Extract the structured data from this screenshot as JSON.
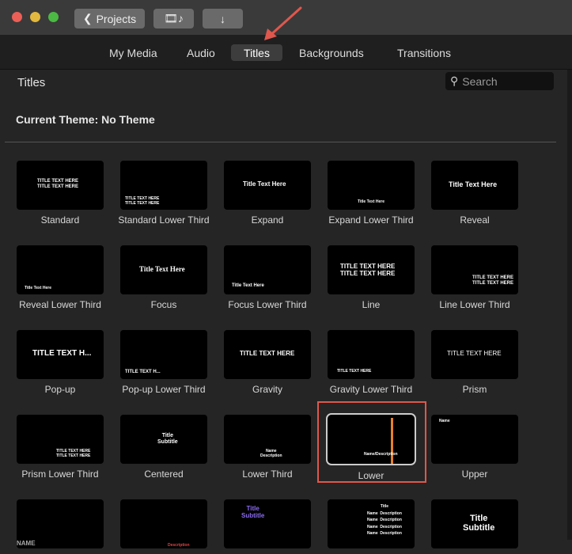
{
  "toolbar": {
    "projects_label": "Projects",
    "media_icon": "film-music-icon",
    "import_icon": "down-arrow-icon"
  },
  "tabs": [
    {
      "label": "My Media"
    },
    {
      "label": "Audio"
    },
    {
      "label": "Titles",
      "active": true
    },
    {
      "label": "Backgrounds"
    },
    {
      "label": "Transitions"
    }
  ],
  "header": {
    "title": "Titles",
    "search_placeholder": "Search"
  },
  "theme": "Current Theme: No Theme",
  "colors": {
    "accent_arrow": "#e0574d",
    "selection": "#e0574d"
  },
  "items": [
    {
      "label": "Standard",
      "preview": "TITLE TEXT HERE\nTITLE TEXT HERE"
    },
    {
      "label": "Standard Lower Third",
      "preview": "TITLE TEXT HERE\nTITLE TEXT HERE"
    },
    {
      "label": "Expand",
      "preview": "Title Text Here"
    },
    {
      "label": "Expand Lower Third",
      "preview": "Title Text Here"
    },
    {
      "label": "Reveal",
      "preview": "Title Text Here"
    },
    {
      "label": "Reveal Lower Third",
      "preview": "Title Text Here"
    },
    {
      "label": "Focus",
      "preview": "Title Text Here"
    },
    {
      "label": "Focus Lower Third",
      "preview": "Title Text Here"
    },
    {
      "label": "Line",
      "preview": "TITLE TEXT HERE\nTITLE TEXT HERE"
    },
    {
      "label": "Line Lower Third",
      "preview": "TITLE TEXT HERE\nTITLE TEXT HERE"
    },
    {
      "label": "Pop-up",
      "preview": "TITLE TEXT H..."
    },
    {
      "label": "Pop-up Lower Third",
      "preview": "TITLE TEXT H..."
    },
    {
      "label": "Gravity",
      "preview": "TITLE TEXT HERE"
    },
    {
      "label": "Gravity Lower Third",
      "preview": "TITLE TEXT HERE"
    },
    {
      "label": "Prism",
      "preview": "TITLE TEXT HERE"
    },
    {
      "label": "Prism Lower Third",
      "preview": "TITLE TEXT HERE\nTITLE TEXT HERE"
    },
    {
      "label": "Centered",
      "preview": "Title\nSubtitle"
    },
    {
      "label": "Lower Third",
      "preview": "Name\nDescription"
    },
    {
      "label": "Lower",
      "preview": "Name/Description",
      "selected": true
    },
    {
      "label": "Upper",
      "preview": "Name"
    },
    {
      "label": "",
      "preview": "NAME"
    },
    {
      "label": "",
      "preview": "Description"
    },
    {
      "label": "",
      "preview": "Title\nSubtitle"
    },
    {
      "label": "",
      "preview": "Title\nName  Description\nName  Description\nName  Description\nName  Description"
    },
    {
      "label": "",
      "preview": "Title\nSubtitle"
    }
  ]
}
